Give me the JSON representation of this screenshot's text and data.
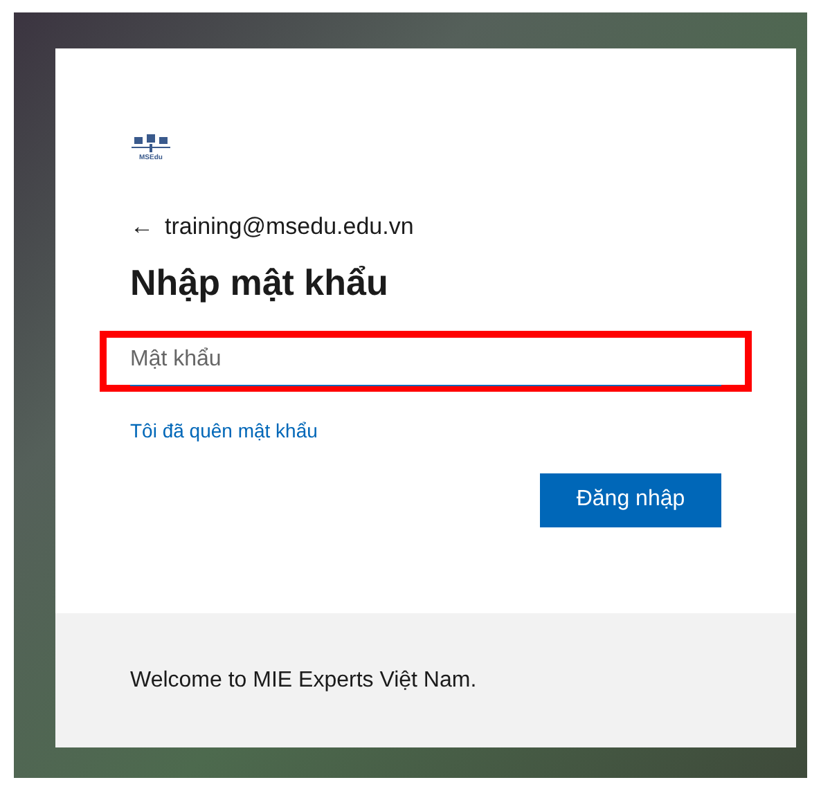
{
  "logo": {
    "text": "MSEdu"
  },
  "account": {
    "back": "←",
    "email": "training@msedu.edu.vn"
  },
  "title": "Nhập mật khẩu",
  "password_field": {
    "placeholder": "Mật khẩu",
    "highlighted": true
  },
  "forgot_link": "Tôi đã quên mật khẩu",
  "sign_in_button": "Đăng nhập",
  "footer": {
    "text": "Welcome to MIE Experts Việt Nam."
  }
}
